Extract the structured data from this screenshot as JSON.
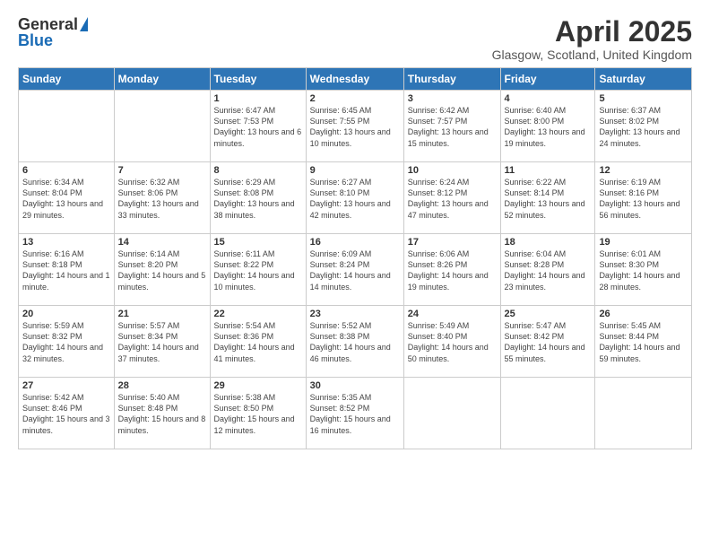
{
  "logo": {
    "general": "General",
    "blue": "Blue"
  },
  "title": "April 2025",
  "subtitle": "Glasgow, Scotland, United Kingdom",
  "days_of_week": [
    "Sunday",
    "Monday",
    "Tuesday",
    "Wednesday",
    "Thursday",
    "Friday",
    "Saturday"
  ],
  "weeks": [
    [
      {
        "day": "",
        "info": ""
      },
      {
        "day": "",
        "info": ""
      },
      {
        "day": "1",
        "info": "Sunrise: 6:47 AM\nSunset: 7:53 PM\nDaylight: 13 hours and 6 minutes."
      },
      {
        "day": "2",
        "info": "Sunrise: 6:45 AM\nSunset: 7:55 PM\nDaylight: 13 hours and 10 minutes."
      },
      {
        "day": "3",
        "info": "Sunrise: 6:42 AM\nSunset: 7:57 PM\nDaylight: 13 hours and 15 minutes."
      },
      {
        "day": "4",
        "info": "Sunrise: 6:40 AM\nSunset: 8:00 PM\nDaylight: 13 hours and 19 minutes."
      },
      {
        "day": "5",
        "info": "Sunrise: 6:37 AM\nSunset: 8:02 PM\nDaylight: 13 hours and 24 minutes."
      }
    ],
    [
      {
        "day": "6",
        "info": "Sunrise: 6:34 AM\nSunset: 8:04 PM\nDaylight: 13 hours and 29 minutes."
      },
      {
        "day": "7",
        "info": "Sunrise: 6:32 AM\nSunset: 8:06 PM\nDaylight: 13 hours and 33 minutes."
      },
      {
        "day": "8",
        "info": "Sunrise: 6:29 AM\nSunset: 8:08 PM\nDaylight: 13 hours and 38 minutes."
      },
      {
        "day": "9",
        "info": "Sunrise: 6:27 AM\nSunset: 8:10 PM\nDaylight: 13 hours and 42 minutes."
      },
      {
        "day": "10",
        "info": "Sunrise: 6:24 AM\nSunset: 8:12 PM\nDaylight: 13 hours and 47 minutes."
      },
      {
        "day": "11",
        "info": "Sunrise: 6:22 AM\nSunset: 8:14 PM\nDaylight: 13 hours and 52 minutes."
      },
      {
        "day": "12",
        "info": "Sunrise: 6:19 AM\nSunset: 8:16 PM\nDaylight: 13 hours and 56 minutes."
      }
    ],
    [
      {
        "day": "13",
        "info": "Sunrise: 6:16 AM\nSunset: 8:18 PM\nDaylight: 14 hours and 1 minute."
      },
      {
        "day": "14",
        "info": "Sunrise: 6:14 AM\nSunset: 8:20 PM\nDaylight: 14 hours and 5 minutes."
      },
      {
        "day": "15",
        "info": "Sunrise: 6:11 AM\nSunset: 8:22 PM\nDaylight: 14 hours and 10 minutes."
      },
      {
        "day": "16",
        "info": "Sunrise: 6:09 AM\nSunset: 8:24 PM\nDaylight: 14 hours and 14 minutes."
      },
      {
        "day": "17",
        "info": "Sunrise: 6:06 AM\nSunset: 8:26 PM\nDaylight: 14 hours and 19 minutes."
      },
      {
        "day": "18",
        "info": "Sunrise: 6:04 AM\nSunset: 8:28 PM\nDaylight: 14 hours and 23 minutes."
      },
      {
        "day": "19",
        "info": "Sunrise: 6:01 AM\nSunset: 8:30 PM\nDaylight: 14 hours and 28 minutes."
      }
    ],
    [
      {
        "day": "20",
        "info": "Sunrise: 5:59 AM\nSunset: 8:32 PM\nDaylight: 14 hours and 32 minutes."
      },
      {
        "day": "21",
        "info": "Sunrise: 5:57 AM\nSunset: 8:34 PM\nDaylight: 14 hours and 37 minutes."
      },
      {
        "day": "22",
        "info": "Sunrise: 5:54 AM\nSunset: 8:36 PM\nDaylight: 14 hours and 41 minutes."
      },
      {
        "day": "23",
        "info": "Sunrise: 5:52 AM\nSunset: 8:38 PM\nDaylight: 14 hours and 46 minutes."
      },
      {
        "day": "24",
        "info": "Sunrise: 5:49 AM\nSunset: 8:40 PM\nDaylight: 14 hours and 50 minutes."
      },
      {
        "day": "25",
        "info": "Sunrise: 5:47 AM\nSunset: 8:42 PM\nDaylight: 14 hours and 55 minutes."
      },
      {
        "day": "26",
        "info": "Sunrise: 5:45 AM\nSunset: 8:44 PM\nDaylight: 14 hours and 59 minutes."
      }
    ],
    [
      {
        "day": "27",
        "info": "Sunrise: 5:42 AM\nSunset: 8:46 PM\nDaylight: 15 hours and 3 minutes."
      },
      {
        "day": "28",
        "info": "Sunrise: 5:40 AM\nSunset: 8:48 PM\nDaylight: 15 hours and 8 minutes."
      },
      {
        "day": "29",
        "info": "Sunrise: 5:38 AM\nSunset: 8:50 PM\nDaylight: 15 hours and 12 minutes."
      },
      {
        "day": "30",
        "info": "Sunrise: 5:35 AM\nSunset: 8:52 PM\nDaylight: 15 hours and 16 minutes."
      },
      {
        "day": "",
        "info": ""
      },
      {
        "day": "",
        "info": ""
      },
      {
        "day": "",
        "info": ""
      }
    ]
  ]
}
